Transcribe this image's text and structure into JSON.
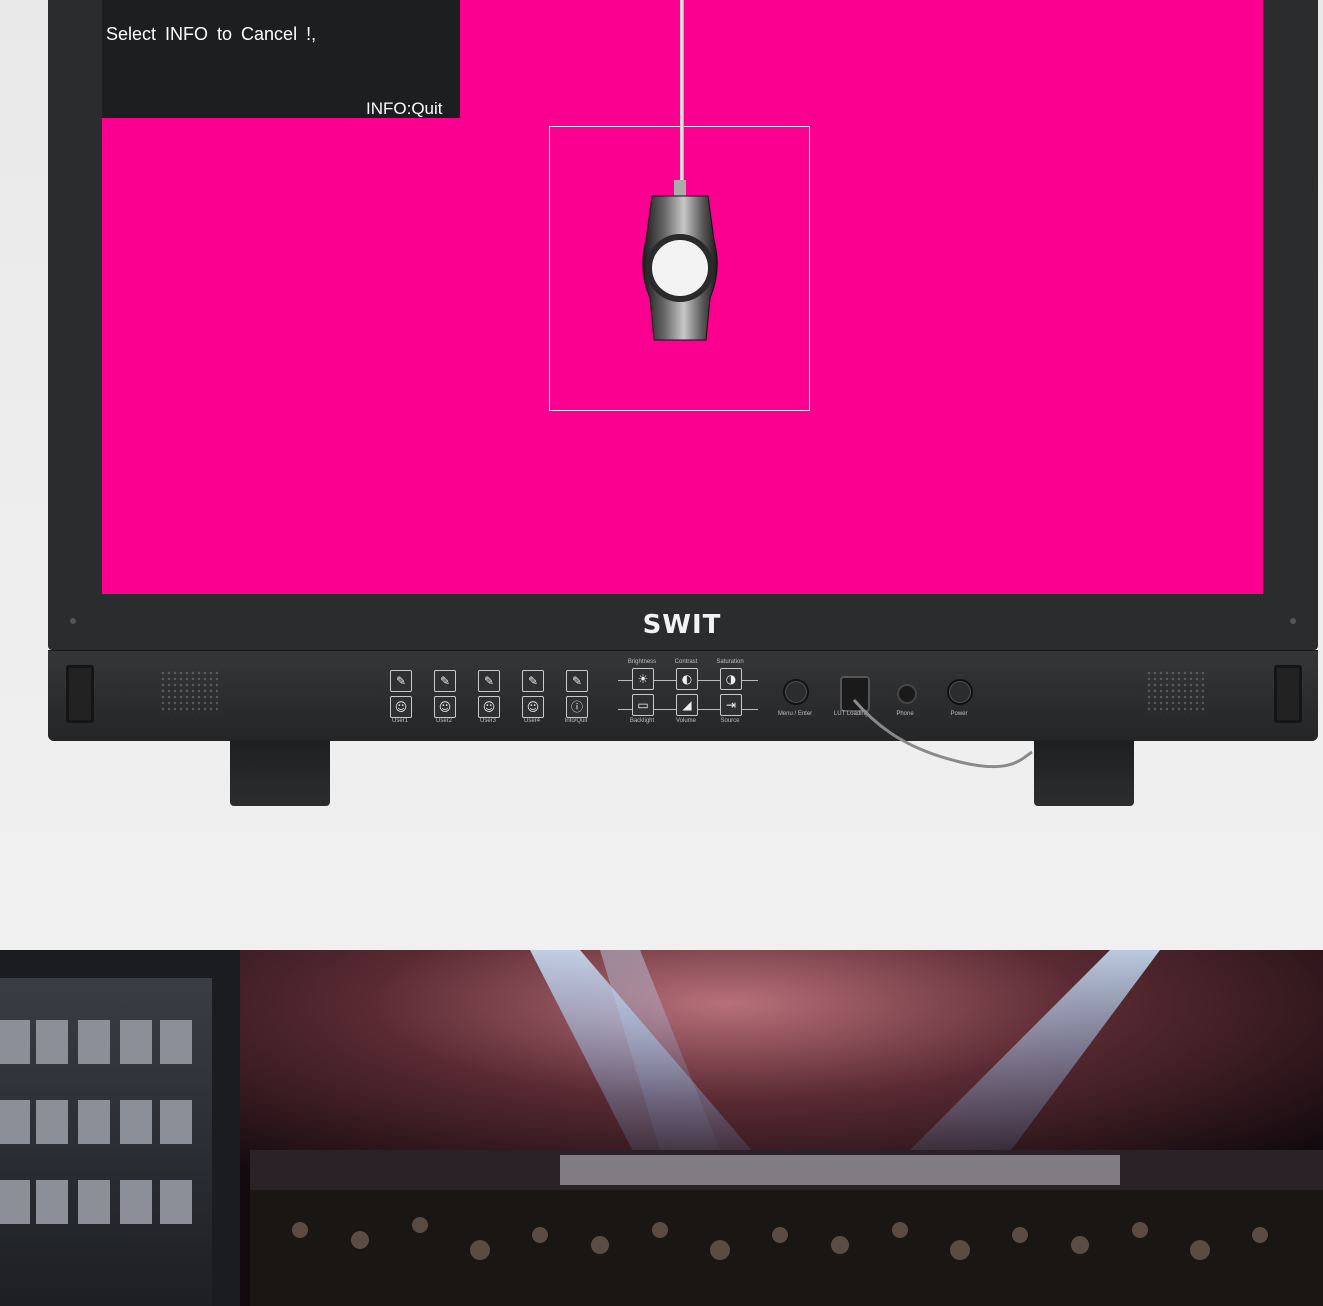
{
  "osd": {
    "message": "Select  INFO  to  Cancel !,",
    "quit_hint": "INFO:Quit"
  },
  "brand": {
    "logo_text": "SWIT"
  },
  "colors": {
    "screen": "#fb0090",
    "bezel": "#2b2c2e",
    "osd_bg": "#1c1e1f"
  },
  "control_panel": {
    "user_buttons": [
      {
        "label": "User1",
        "icon": "pencil-icon",
        "icon2": "person-icon"
      },
      {
        "label": "User2",
        "icon": "pencil-icon",
        "icon2": "person-icon"
      },
      {
        "label": "User3",
        "icon": "pencil-icon",
        "icon2": "person-icon"
      },
      {
        "label": "User4",
        "icon": "pencil-icon",
        "icon2": "person-icon"
      },
      {
        "label": "Info/Quit",
        "icon": "pencil-icon",
        "icon2": "info-icon"
      }
    ],
    "adjust_top_labels": [
      "Brightness",
      "Contrast",
      "Saturation"
    ],
    "adjust_bottom_labels": [
      "Backlight",
      "Volume",
      "Source"
    ],
    "knobs": [
      {
        "label": "Menu / Enter"
      },
      {
        "label": "LUT Loading"
      },
      {
        "label": "Phone"
      },
      {
        "label": "Power"
      }
    ]
  }
}
